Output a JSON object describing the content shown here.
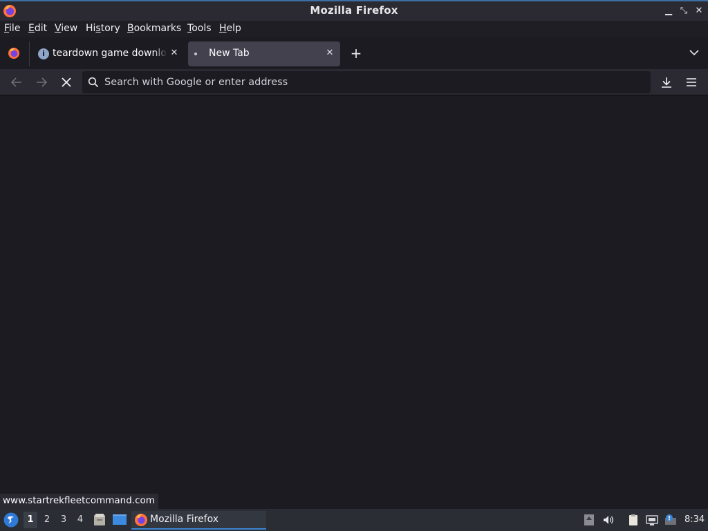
{
  "window": {
    "title": "Mozilla Firefox",
    "controls": {
      "minimize": "▁",
      "restore": "⤡",
      "close": "✕"
    }
  },
  "menu": {
    "items": [
      {
        "prefix": "",
        "accel": "F",
        "rest": "ile"
      },
      {
        "prefix": "",
        "accel": "E",
        "rest": "dit"
      },
      {
        "prefix": "",
        "accel": "V",
        "rest": "iew"
      },
      {
        "prefix": "Hi",
        "accel": "s",
        "rest": "tory"
      },
      {
        "prefix": "",
        "accel": "B",
        "rest": "ookmarks"
      },
      {
        "prefix": "",
        "accel": "T",
        "rest": "ools"
      },
      {
        "prefix": "",
        "accel": "H",
        "rest": "elp"
      }
    ]
  },
  "tabs": [
    {
      "title": "teardown game download",
      "icon": "info-icon",
      "active": false
    },
    {
      "title": "New Tab",
      "icon": "dot-icon",
      "active": true
    }
  ],
  "tab_close_glyph": "✕",
  "new_tab_glyph": "+",
  "info_glyph": "i",
  "urlbar": {
    "placeholder": "Search with Google or enter address",
    "value": ""
  },
  "status_url": "www.startrekfleetcommand.com",
  "taskbar": {
    "workspaces": [
      "1",
      "2",
      "3",
      "4"
    ],
    "active_workspace": "1",
    "task_label": "Mozilla Firefox",
    "clock": "8:34"
  },
  "colors": {
    "accent": "#3b86d6",
    "content_bg": "#1c1b22",
    "toolbar_bg": "#2b2a33",
    "firefox_orange": "#ff7139"
  }
}
